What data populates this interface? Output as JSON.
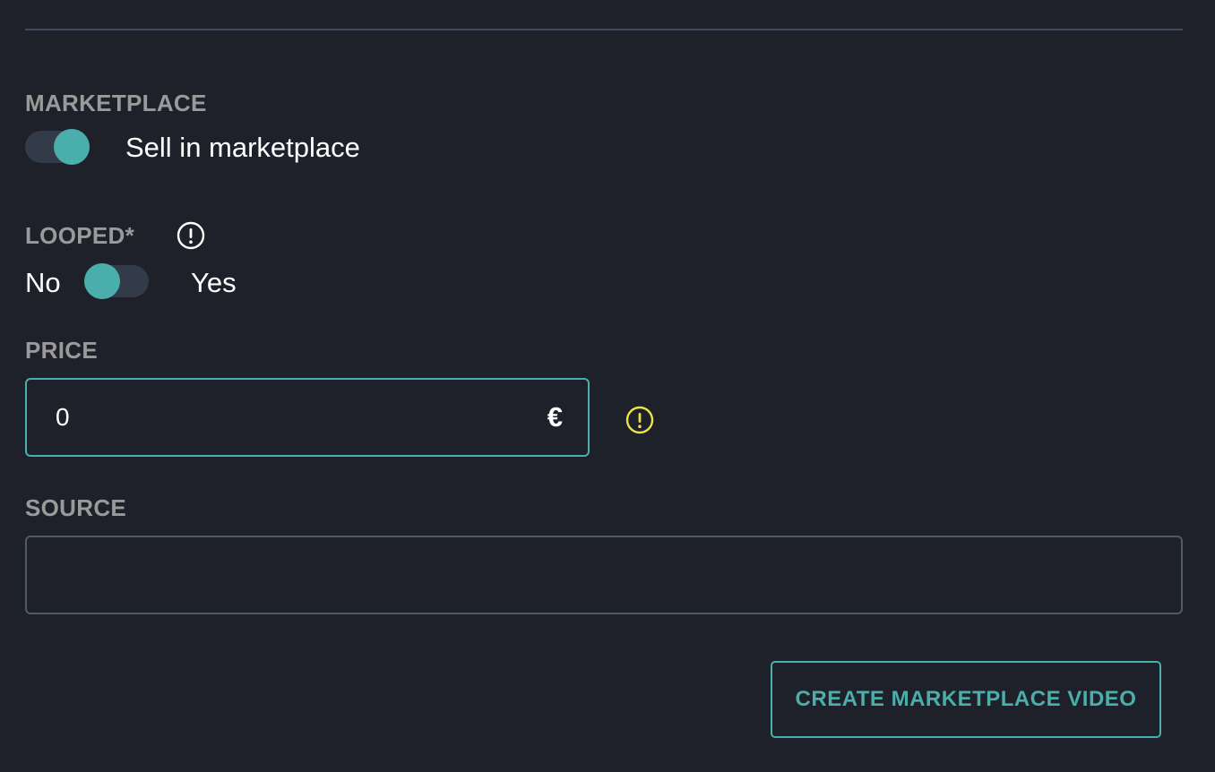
{
  "colors": {
    "background": "#1e2129",
    "accent": "#4aafab",
    "label": "#9a9a9a",
    "warning": "#e8e24a",
    "toggle_track": "#343b48"
  },
  "marketplace": {
    "label": "MARKETPLACE",
    "toggle_state": "on",
    "toggle_text": "Sell in marketplace"
  },
  "looped": {
    "label": "LOOPED*",
    "info_icon": "info-icon",
    "no_label": "No",
    "yes_label": "Yes",
    "toggle_state": "off"
  },
  "price": {
    "label": "PRICE",
    "value": "0",
    "currency": "€",
    "warning_icon": "warning-icon"
  },
  "source": {
    "label": "SOURCE",
    "value": ""
  },
  "actions": {
    "create_label": "CREATE MARKETPLACE VIDEO"
  }
}
